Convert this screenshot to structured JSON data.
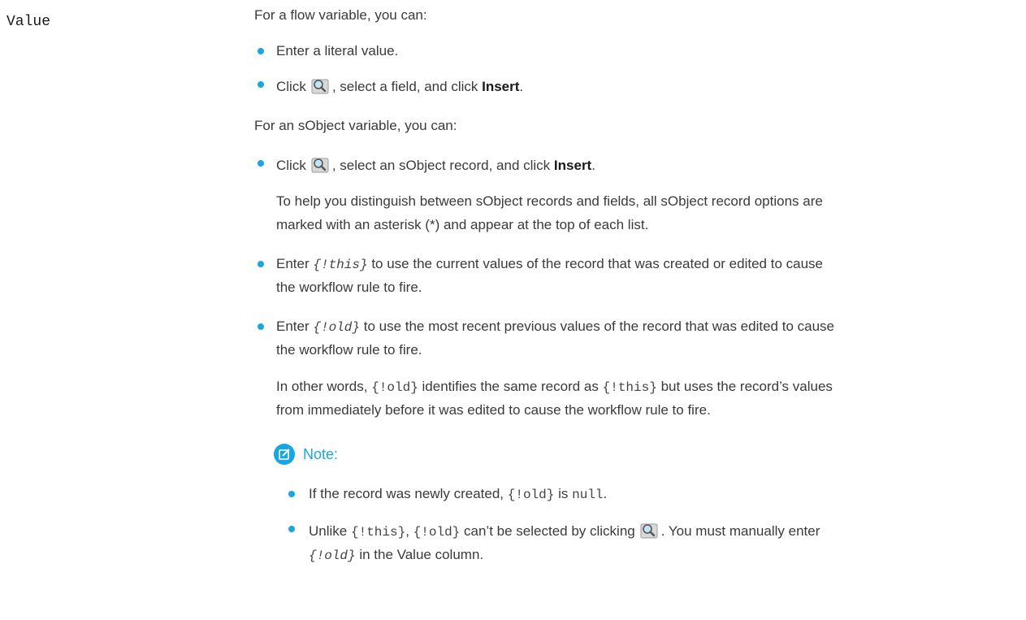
{
  "term": "Value",
  "flow_intro": "For a flow variable, you can:",
  "flow_items": {
    "literal": "Enter a literal value.",
    "click_pre": "Click",
    "click_post": ", select a field, and click",
    "insert": "Insert",
    "period": "."
  },
  "sobject_intro": "For an sObject variable, you can:",
  "sobject_items": {
    "click_pre": "Click",
    "click_post": ", select an sObject record, and click",
    "insert": "Insert",
    "period": ".",
    "hint_line1": "To help you distinguish between sObject records and fields, all sObject record options are",
    "hint_line2": "marked with an asterisk (*) and appear at the top of each list.",
    "enter": "Enter",
    "this_code": "{!this}",
    "this_line1": "to use the current values of the record that was created or edited to cause",
    "this_line2": "the workflow rule to fire.",
    "old_code": "{!old}",
    "old_line1": "to use the most recent previous values of the record that was edited to cause",
    "old_line2": "the workflow rule to fire.",
    "words_pre": "In other words,",
    "words_mid": "identifies the same record as",
    "words_post": "but uses the record’s values",
    "words_line2": "from immediately before it was edited to cause the workflow rule to fire."
  },
  "note": {
    "title": "Note:",
    "item1_pre": "If the record was newly created,",
    "item1_code1": "{!old}",
    "item1_is": "is",
    "item1_code2": "null",
    "item1_end": ".",
    "item2_pre": "Unlike",
    "item2_code_this": "{!this}",
    "item2_comma": ",",
    "item2_code_old": "{!old}",
    "item2_mid": "can’t be selected by clicking",
    "item2_post": ". You must manually enter",
    "item2_code_old2": "{!old}",
    "item2_line2_post": "in the Value column."
  },
  "colors": {
    "accent": "#1aa5e3",
    "text": "#3a3a3a"
  },
  "icons": {
    "lookup": "lookup-magnifier-icon",
    "note": "note-edit-icon"
  }
}
